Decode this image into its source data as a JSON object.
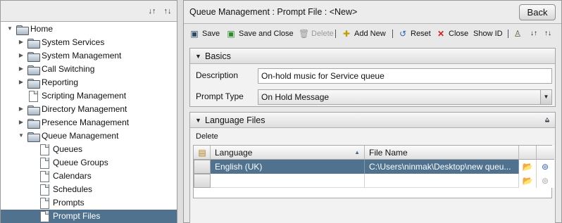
{
  "tree": {
    "items": [
      {
        "label": "Home",
        "level": 0,
        "type": "folder",
        "state": "expanded",
        "selected": false
      },
      {
        "label": "System Services",
        "level": 1,
        "type": "folder",
        "state": "collapsed",
        "selected": false
      },
      {
        "label": "System Management",
        "level": 1,
        "type": "folder",
        "state": "collapsed",
        "selected": false
      },
      {
        "label": "Call Switching",
        "level": 1,
        "type": "folder",
        "state": "collapsed",
        "selected": false
      },
      {
        "label": "Reporting",
        "level": 1,
        "type": "folder",
        "state": "collapsed",
        "selected": false
      },
      {
        "label": "Scripting Management",
        "level": 1,
        "type": "doc",
        "state": "none",
        "selected": false
      },
      {
        "label": "Directory Management",
        "level": 1,
        "type": "folder",
        "state": "collapsed",
        "selected": false
      },
      {
        "label": "Presence Management",
        "level": 1,
        "type": "folder",
        "state": "collapsed",
        "selected": false
      },
      {
        "label": "Queue Management",
        "level": 1,
        "type": "folder",
        "state": "expanded",
        "selected": false
      },
      {
        "label": "Queues",
        "level": 2,
        "type": "doc",
        "state": "none",
        "selected": false
      },
      {
        "label": "Queue Groups",
        "level": 2,
        "type": "doc",
        "state": "none",
        "selected": false
      },
      {
        "label": "Calendars",
        "level": 2,
        "type": "doc",
        "state": "none",
        "selected": false
      },
      {
        "label": "Schedules",
        "level": 2,
        "type": "doc",
        "state": "none",
        "selected": false
      },
      {
        "label": "Prompts",
        "level": 2,
        "type": "doc",
        "state": "none",
        "selected": false
      },
      {
        "label": "Prompt Files",
        "level": 2,
        "type": "doc",
        "state": "none",
        "selected": true
      }
    ]
  },
  "header": {
    "title": "Queue Management : Prompt File : <New>",
    "back_label": "Back"
  },
  "toolbar": {
    "save": "Save",
    "save_close": "Save and Close",
    "delete": "Delete",
    "add_new": "Add New",
    "reset": "Reset",
    "close": "Close",
    "show_id": "Show ID"
  },
  "basics": {
    "title": "Basics",
    "description_label": "Description",
    "description_value": "On-hold music for Service queue",
    "prompt_type_label": "Prompt Type",
    "prompt_type_value": "On Hold Message"
  },
  "language_files": {
    "title": "Language Files",
    "delete_label": "Delete",
    "columns": [
      "Language",
      "File Name"
    ],
    "rows": [
      {
        "language": "English (UK)",
        "file_name": "C:\\Users\\ninmak\\Desktop\\new queu..."
      }
    ]
  },
  "colors": {
    "selection": "#50728f",
    "close_icon": "#d21f1f",
    "reset_icon": "#2f5fb0"
  },
  "icons": {
    "sort_asc": "sort-ascending-icon",
    "sort_desc": "sort-descending-icon"
  }
}
